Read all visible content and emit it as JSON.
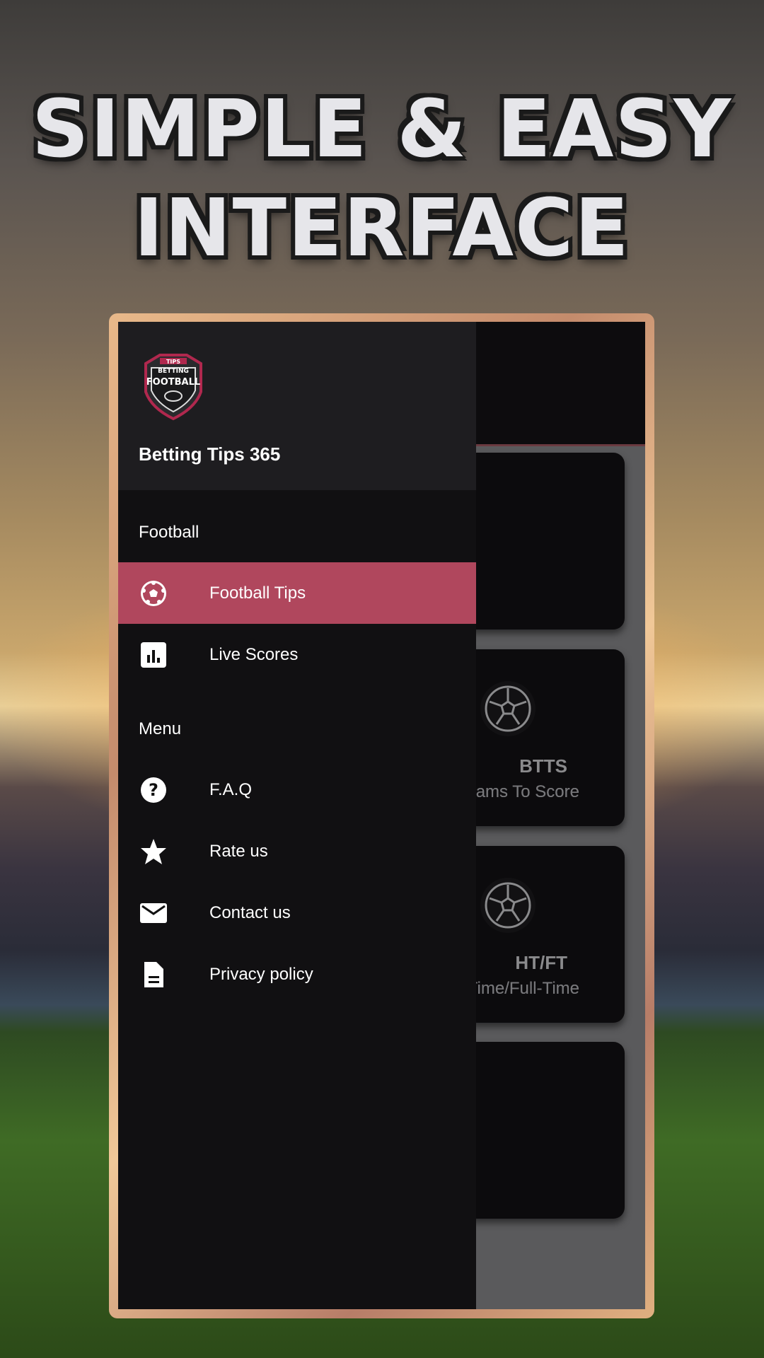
{
  "headline": {
    "line1": "SIMPLE & EASY",
    "line2": "INTERFACE"
  },
  "drawer": {
    "logo_text": [
      "TIPS",
      "BETTING",
      "FOOTBALL"
    ],
    "app_title": "Betting Tips 365",
    "sections": [
      {
        "title": "Football",
        "items": [
          {
            "label": "Football Tips",
            "icon": "soccer-ball-icon",
            "active": true
          },
          {
            "label": "Live Scores",
            "icon": "bar-chart-icon",
            "active": false
          }
        ]
      },
      {
        "title": "Menu",
        "items": [
          {
            "label": "F.A.Q",
            "icon": "help-circle-icon"
          },
          {
            "label": "Rate us",
            "icon": "star-icon"
          },
          {
            "label": "Contact us",
            "icon": "mail-icon"
          },
          {
            "label": "Privacy policy",
            "icon": "document-icon"
          }
        ]
      }
    ]
  },
  "cards": [
    {
      "title": "BTTS",
      "subtitle": "Both Teams To Score",
      "visible_subtitle": "eams To Score"
    },
    {
      "title": "HT/FT",
      "subtitle": "Half-Time/Full-Time",
      "visible_subtitle": "ime/Full-Time"
    }
  ],
  "colors": {
    "accent": "#b0475d",
    "drawer_bg": "#111012",
    "header_bg": "#1e1d20"
  }
}
